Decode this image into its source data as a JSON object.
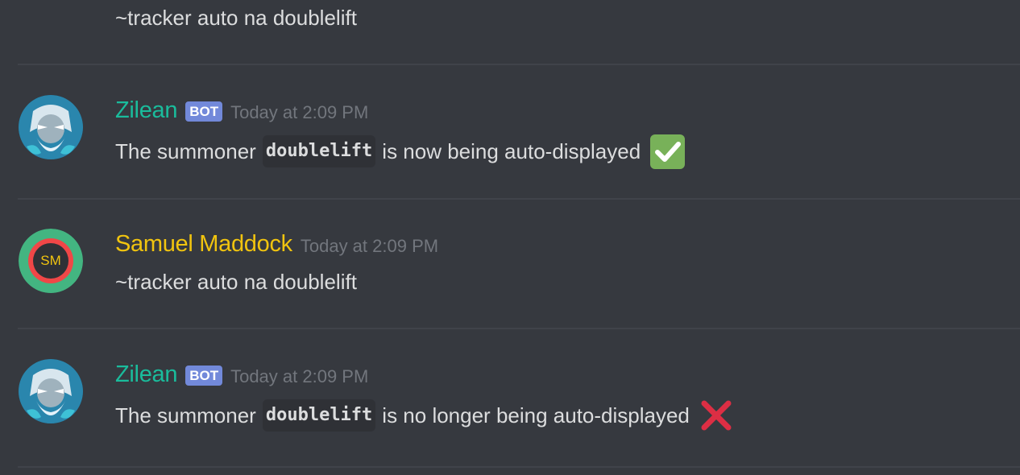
{
  "messages": [
    {
      "type": "continuation",
      "text": "~tracker auto na doublelift"
    },
    {
      "type": "group",
      "avatar_icon": "zilean-avatar-icon",
      "username": "Zilean",
      "username_color": "#1abc9c",
      "badge": "BOT",
      "timestamp": "Today at 2:09 PM",
      "text_before": "The summoner",
      "code": "doublelift",
      "text_after": "is now being auto-displayed",
      "emoji": "white-check-mark-icon"
    },
    {
      "type": "group",
      "avatar_icon": "sm-initials-avatar",
      "avatar_initials": "SM",
      "username": "Samuel Maddock",
      "username_color": "#f1c40f",
      "timestamp": "Today at 2:09 PM",
      "text": "~tracker auto na doublelift"
    },
    {
      "type": "group",
      "avatar_icon": "zilean-avatar-icon",
      "username": "Zilean",
      "username_color": "#1abc9c",
      "badge": "BOT",
      "timestamp": "Today at 2:09 PM",
      "text_before": "The summoner",
      "code": "doublelift",
      "text_after": "is no longer being auto-displayed",
      "emoji": "cross-mark-icon"
    }
  ],
  "colors": {
    "background": "#36393f",
    "text": "#dcddde",
    "timestamp": "#72767d",
    "bot_badge": "#7289da",
    "code_background": "#2f3136",
    "check_green": "#78b159",
    "cross_red": "#dd2e44",
    "sm_ring": "#43b581",
    "sm_inner_ring": "#f04747"
  }
}
